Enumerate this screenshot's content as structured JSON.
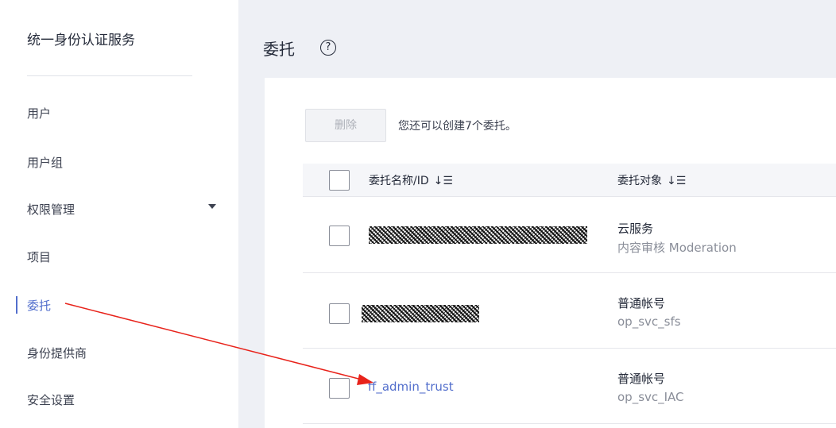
{
  "sidebar": {
    "title": "统一身份认证服务",
    "items": [
      {
        "label": "用户",
        "active": false
      },
      {
        "label": "用户组",
        "active": false
      },
      {
        "label": "权限管理",
        "active": false,
        "has_dropdown": true
      },
      {
        "label": "项目",
        "active": false
      },
      {
        "label": "委托",
        "active": true
      },
      {
        "label": "身份提供商",
        "active": false
      },
      {
        "label": "安全设置",
        "active": false
      }
    ]
  },
  "main": {
    "title": "委托",
    "help_icon": "?",
    "toolbar": {
      "delete_label": "删除",
      "quota_text": "您还可以创建7个委托。"
    },
    "table": {
      "columns": [
        {
          "label": "委托名称/ID",
          "sort_icon": "↓☰"
        },
        {
          "label": "委托对象",
          "sort_icon": "↓☰"
        }
      ],
      "rows": [
        {
          "name": "",
          "name_redacted": true,
          "object": "云服务",
          "object_detail": "内容审核 Moderation"
        },
        {
          "name": "",
          "name_redacted": true,
          "object": "普通帐号",
          "object_detail": "op_svc_sfs"
        },
        {
          "name": "ff_admin_trust",
          "name_redacted": false,
          "object": "普通帐号",
          "object_detail": "op_svc_IAC"
        }
      ]
    }
  },
  "colors": {
    "accent": "#526ecc",
    "annotation_arrow": "#e8231b"
  },
  "icons": {
    "help": "question-circle-icon",
    "dropdown": "caret-down-icon",
    "sort": "sort-icon"
  }
}
